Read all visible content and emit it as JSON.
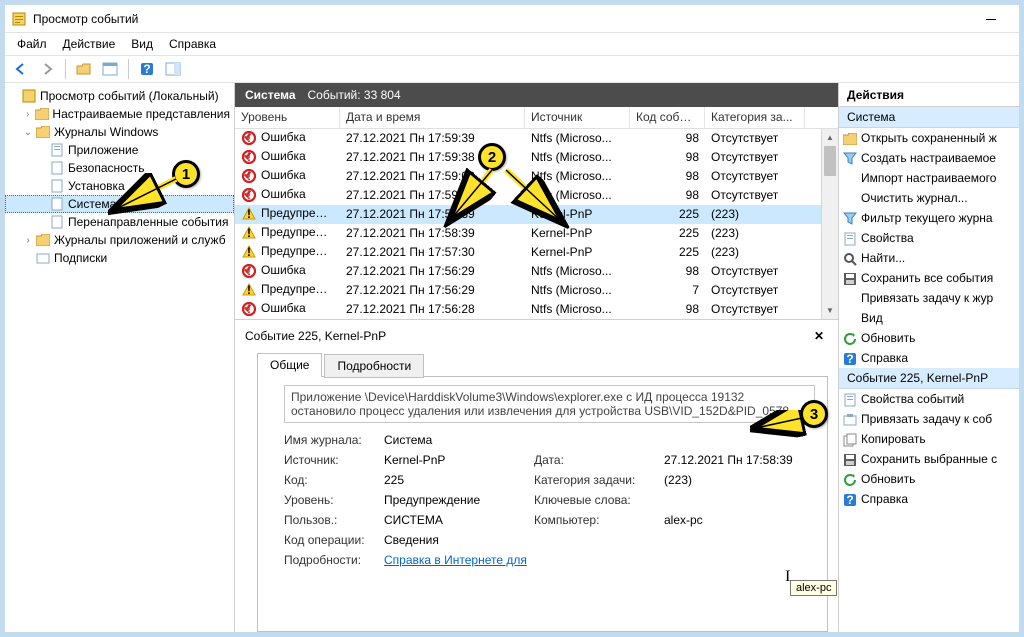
{
  "window": {
    "title": "Просмотр событий"
  },
  "menu": [
    "Файл",
    "Действие",
    "Вид",
    "Справка"
  ],
  "tree": {
    "root": "Просмотр событий (Локальный)",
    "custom_views": "Настраиваемые представления",
    "winlogs": "Журналы Windows",
    "winlogs_children": {
      "app": "Приложение",
      "sec": "Безопасность",
      "setup": "Установка",
      "system": "Система",
      "fwd": "Перенаправленные события"
    },
    "applogs": "Журналы приложений и служб",
    "subs": "Подписки"
  },
  "list": {
    "category": "Система",
    "countlabel": "Событий: 33 804",
    "cols": {
      "level": "Уровень",
      "datetime": "Дата и время",
      "source": "Источник",
      "eventid": "Код события",
      "taskcat": "Категория за..."
    },
    "rows": [
      {
        "lvl": "Ошибка",
        "lvlk": "err",
        "dt": "27.12.2021 Пн 17:59:39",
        "src": "Ntfs (Microso...",
        "eid": "98",
        "cat": "Отсутствует"
      },
      {
        "lvl": "Ошибка",
        "lvlk": "err",
        "dt": "27.12.2021 Пн 17:59:38",
        "src": "Ntfs (Microso...",
        "eid": "98",
        "cat": "Отсутствует"
      },
      {
        "lvl": "Ошибка",
        "lvlk": "err",
        "dt": "27.12.2021 Пн 17:59:08",
        "src": "Ntfs (Microso...",
        "eid": "98",
        "cat": "Отсутствует"
      },
      {
        "lvl": "Ошибка",
        "lvlk": "err",
        "dt": "27.12.2021 Пн 17:59:07",
        "src": "Ntfs (Microso...",
        "eid": "98",
        "cat": "Отсутствует"
      },
      {
        "lvl": "Предупреждение",
        "lvlk": "warn",
        "dt": "27.12.2021 Пн 17:58:39",
        "src": "Kernel-PnP",
        "eid": "225",
        "cat": "(223)",
        "sel": true
      },
      {
        "lvl": "Предупреждение",
        "lvlk": "warn",
        "dt": "27.12.2021 Пн 17:58:39",
        "src": "Kernel-PnP",
        "eid": "225",
        "cat": "(223)"
      },
      {
        "lvl": "Предупреждение",
        "lvlk": "warn",
        "dt": "27.12.2021 Пн 17:57:30",
        "src": "Kernel-PnP",
        "eid": "225",
        "cat": "(223)"
      },
      {
        "lvl": "Ошибка",
        "lvlk": "err",
        "dt": "27.12.2021 Пн 17:56:29",
        "src": "Ntfs (Microso...",
        "eid": "98",
        "cat": "Отсутствует"
      },
      {
        "lvl": "Предупреждение",
        "lvlk": "warn",
        "dt": "27.12.2021 Пн 17:56:29",
        "src": "Ntfs (Microso...",
        "eid": "7",
        "cat": "Отсутствует"
      },
      {
        "lvl": "Ошибка",
        "lvlk": "err",
        "dt": "27.12.2021 Пн 17:56:28",
        "src": "Ntfs (Microso...",
        "eid": "98",
        "cat": "Отсутствует"
      }
    ]
  },
  "details": {
    "title": "Событие 225, Kernel-PnP",
    "tab_general": "Общие",
    "tab_details": "Подробности",
    "message": "Приложение \\Device\\HarddiskVolume3\\Windows\\explorer.exe с ИД процесса 19132 остановило процесс удаления или извлечения для устройства USB\\VID_152D&PID_0578",
    "logname_l": "Имя журнала:",
    "logname_v": "Система",
    "source_l": "Источник:",
    "source_v": "Kernel-PnP",
    "date_l": "Дата:",
    "date_v": "27.12.2021 Пн 17:58:39",
    "eid_l": "Код:",
    "eid_v": "225",
    "task_l": "Категория задачи:",
    "task_v": "(223)",
    "level_l": "Уровень:",
    "level_v": "Предупреждение",
    "keywords_l": "Ключевые слова:",
    "keywords_v": "",
    "user_l": "Пользов.:",
    "user_v": "СИСТЕМА",
    "computer_l": "Компьютер:",
    "computer_v": "alex-pc",
    "opcode_l": "Код операции:",
    "opcode_v": "Сведения",
    "more_l": "Подробности:",
    "more_link": "Справка в Интернете для",
    "tooltip": "alex-pc"
  },
  "actions": {
    "header": "Действия",
    "group1_title": "Система",
    "items1": [
      {
        "icon": "folder",
        "label": "Открыть сохраненный ж"
      },
      {
        "icon": "filter-new",
        "label": "Создать настраиваемое"
      },
      {
        "icon": "none",
        "label": "Импорт настраиваемого"
      },
      {
        "icon": "none",
        "label": "Очистить журнал..."
      },
      {
        "icon": "filter",
        "label": "Фильтр текущего журна"
      },
      {
        "icon": "props",
        "label": "Свойства"
      },
      {
        "icon": "find",
        "label": "Найти..."
      },
      {
        "icon": "save",
        "label": "Сохранить все события"
      },
      {
        "icon": "none",
        "label": "Привязать задачу к жур"
      },
      {
        "icon": "none",
        "label": "Вид"
      },
      {
        "icon": "refresh",
        "label": "Обновить"
      },
      {
        "icon": "help",
        "label": "Справка"
      }
    ],
    "group2_title": "Событие 225, Kernel-PnP",
    "items2": [
      {
        "icon": "props",
        "label": "Свойства событий"
      },
      {
        "icon": "task",
        "label": "Привязать задачу к соб"
      },
      {
        "icon": "copy",
        "label": "Копировать"
      },
      {
        "icon": "save",
        "label": "Сохранить выбранные с"
      },
      {
        "icon": "refresh",
        "label": "Обновить"
      },
      {
        "icon": "help",
        "label": "Справка"
      }
    ]
  }
}
